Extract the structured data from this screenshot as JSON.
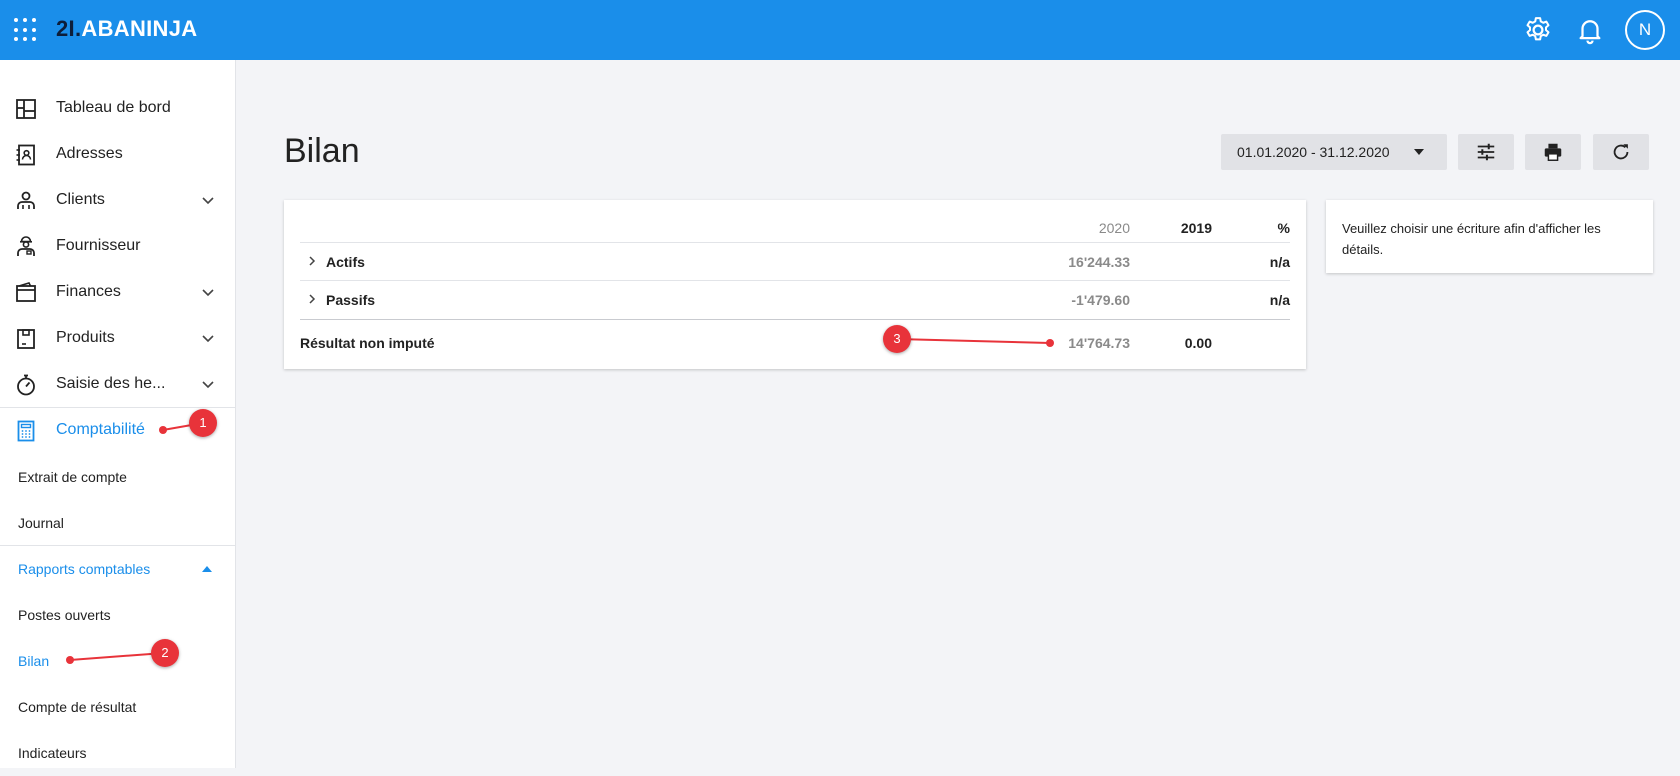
{
  "header": {
    "logo_prefix": "2I.",
    "logo_text": "ABANINJA",
    "avatar_letter": "N"
  },
  "sidebar": {
    "items": [
      {
        "label": "Tableau de bord",
        "icon": "dashboard-icon"
      },
      {
        "label": "Adresses",
        "icon": "address-book-icon"
      },
      {
        "label": "Clients",
        "icon": "clients-icon"
      },
      {
        "label": "Fournisseur",
        "icon": "supplier-icon"
      },
      {
        "label": "Finances",
        "icon": "wallet-icon"
      },
      {
        "label": "Produits",
        "icon": "product-box-icon"
      },
      {
        "label": "Saisie des he...",
        "icon": "stopwatch-icon"
      },
      {
        "label": "Comptabilité",
        "icon": "calculator-icon"
      }
    ],
    "sub_items": [
      {
        "label": "Extrait de compte"
      },
      {
        "label": "Journal"
      },
      {
        "label": "Rapports comptables"
      },
      {
        "label": "Postes ouverts"
      },
      {
        "label": "Bilan"
      },
      {
        "label": "Compte de résultat"
      },
      {
        "label": "Indicateurs"
      }
    ]
  },
  "main": {
    "title": "Bilan",
    "date_range": "01.01.2020 - 31.12.2020",
    "table": {
      "columns": [
        "2020",
        "2019",
        "%"
      ],
      "rows": [
        {
          "label": "Actifs",
          "v2020": "16'244.33",
          "v2019": "",
          "pct": "n/a"
        },
        {
          "label": "Passifs",
          "v2020": "-1'479.60",
          "v2019": "",
          "pct": "n/a"
        }
      ],
      "total": {
        "label": "Résultat non imputé",
        "v2020": "14'764.73",
        "v2019": "0.00",
        "pct": ""
      }
    },
    "detail_message": "Veuillez choisir une écriture afin d'afficher les détails."
  },
  "annotations": [
    "1",
    "2",
    "3"
  ],
  "colors": {
    "accent": "#1a8eea",
    "marker": "#e8333a",
    "topbar": "#1a8eea"
  }
}
